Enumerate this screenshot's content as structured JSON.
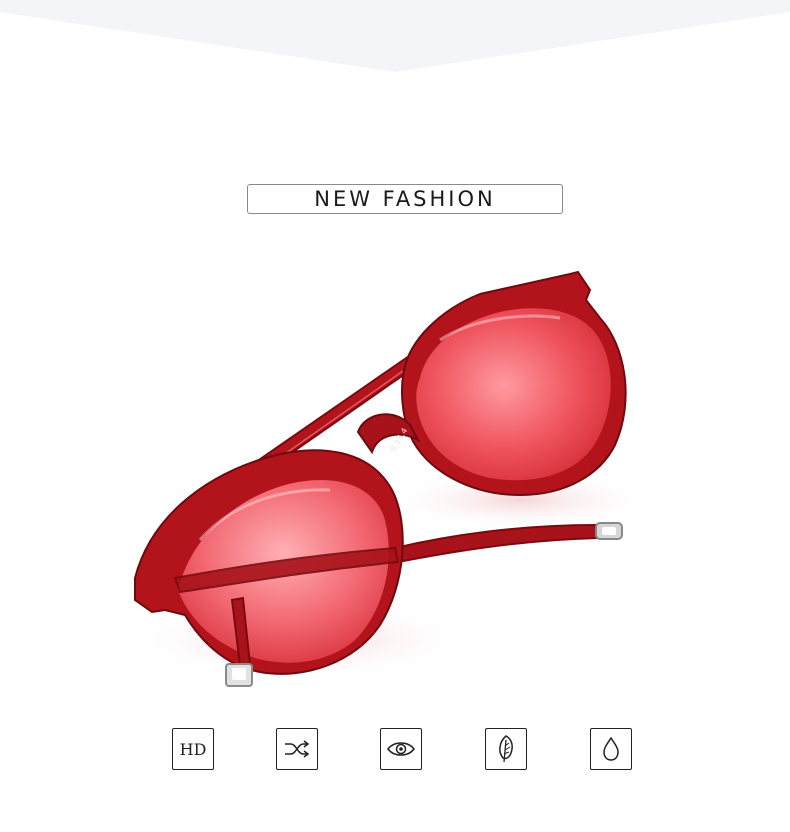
{
  "banner": {
    "color": "#f4f5f8"
  },
  "title": {
    "text": "NEW FASHION"
  },
  "product": {
    "frame_color": "#b3141c",
    "lens_color": "#f0555f",
    "temple_code": "8.15.4"
  },
  "features": [
    {
      "icon": "hd-icon",
      "label": "HD"
    },
    {
      "icon": "shuffle-icon"
    },
    {
      "icon": "eye-icon"
    },
    {
      "icon": "feather-icon"
    },
    {
      "icon": "water-drop-icon"
    }
  ]
}
